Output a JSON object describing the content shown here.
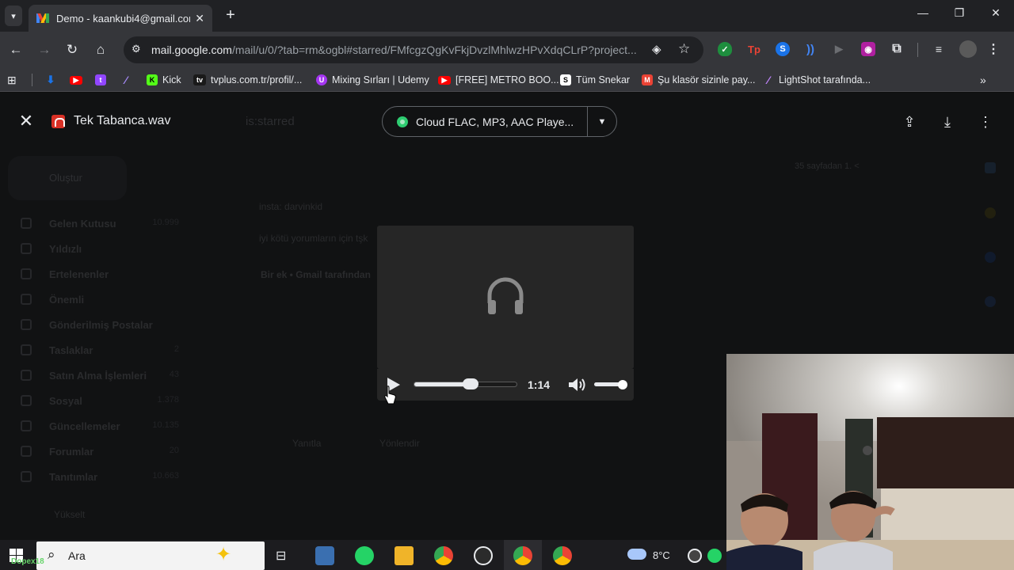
{
  "tab": {
    "title": "Demo - kaankubi4@gmail.com"
  },
  "url": {
    "host": "mail.google.com",
    "path": "/mail/u/0/?tab=rm&ogbl#starred/FMfcgzQgKvFkjDvzlMhlwzHPvXdqCLrP?project..."
  },
  "bookmarks": [
    {
      "label": "Kick",
      "icon": "kick-icon"
    },
    {
      "label": "tvplus.com.tr/profil/...",
      "icon": "tvplus-icon"
    },
    {
      "label": "Mixing Sırları | Udemy",
      "icon": "udemy-icon"
    },
    {
      "label": "[FREE] METRO BOO...",
      "icon": "youtube-icon"
    },
    {
      "label": "Tüm Snekar",
      "icon": "snekar-icon"
    },
    {
      "label": "Şu klasör sizinle pay...",
      "icon": "gmail-icon"
    },
    {
      "label": "LightShot tarafında...",
      "icon": "lightshot-icon"
    }
  ],
  "viewer": {
    "file_name": "Tek Tabanca.wav",
    "open_with": "Cloud FLAC, MP3, AAC Playe..."
  },
  "player": {
    "time": "1:14",
    "progress": 0.55,
    "volume": 0.85
  },
  "gmail_bg": {
    "search": "is:starred",
    "compose": "Oluştur",
    "sidebar": [
      {
        "label": "Gelen Kutusu",
        "count": "10.999"
      },
      {
        "label": "Yıldızlı",
        "count": ""
      },
      {
        "label": "Ertelenenler",
        "count": ""
      },
      {
        "label": "Önemli",
        "count": ""
      },
      {
        "label": "Gönderilmiş Postalar",
        "count": ""
      },
      {
        "label": "Taslaklar",
        "count": "2"
      },
      {
        "label": "Satın Alma İşlemleri",
        "count": "43"
      },
      {
        "label": "Sosyal",
        "count": "1.378"
      },
      {
        "label": "Güncellemeler",
        "count": "10.135"
      },
      {
        "label": "Forumlar",
        "count": "20"
      },
      {
        "label": "Tanıtımlar",
        "count": "10.663"
      }
    ],
    "subject": "insta: darvinkid",
    "snippet": "iyi kötü yorumların için tşk",
    "attach": "Bir ek  •  Gmail tarafından",
    "reply": "Yanıtla",
    "forward": "Yönlendir",
    "upgrade": "Yükselt",
    "pager": "35 sayfadan 1.  <"
  },
  "taskbar": {
    "search": "Ara",
    "temp": "8°C",
    "streamer": "Dopex18"
  }
}
